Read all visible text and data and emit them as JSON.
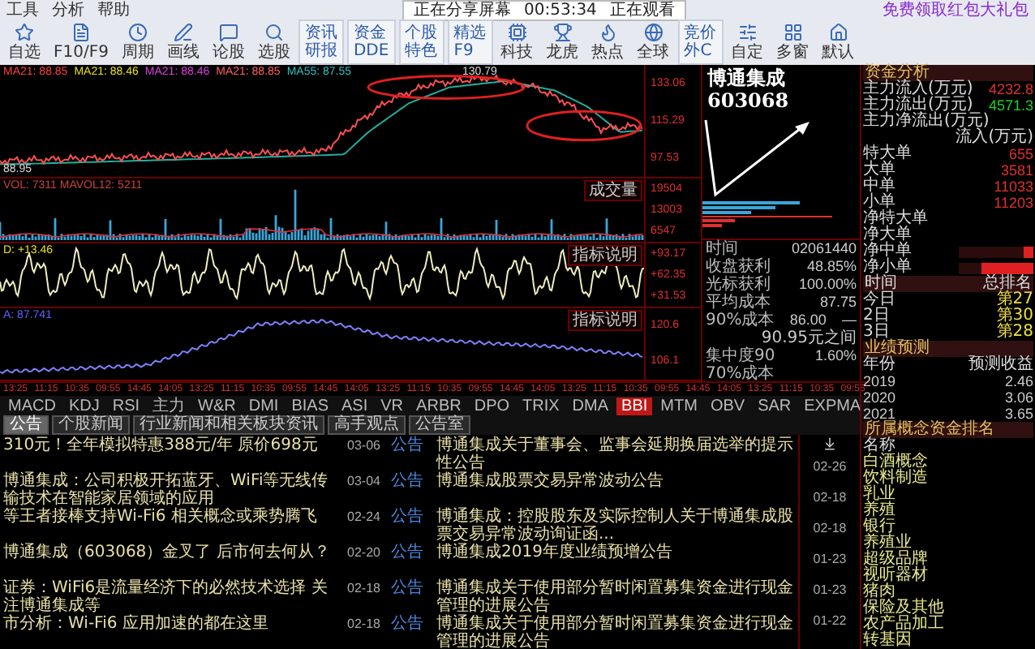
{
  "menu": [
    "工具",
    "分析",
    "帮助"
  ],
  "share_banner": {
    "status": "正在分享屏幕",
    "time": "00:53:34",
    "viewers": "正在观看"
  },
  "promo": "免费领取红包大礼包",
  "toolbar": [
    {
      "kind": "icon",
      "label": "自选"
    },
    {
      "kind": "icon",
      "label": "F10/F9"
    },
    {
      "kind": "icon",
      "label": "周期"
    },
    {
      "kind": "icon",
      "label": "画线"
    },
    {
      "kind": "icon",
      "label": "论股"
    },
    {
      "kind": "icon",
      "label": "选股"
    },
    {
      "kind": "stack",
      "labels": [
        "资讯",
        "研报"
      ]
    },
    {
      "kind": "stack",
      "labels": [
        "资金",
        "DDE"
      ]
    },
    {
      "kind": "stack",
      "labels": [
        "个股",
        "特色"
      ]
    },
    {
      "kind": "stack",
      "labels": [
        "精选",
        "F9"
      ]
    },
    {
      "kind": "icon",
      "label": "科技"
    },
    {
      "kind": "icon",
      "label": "龙虎"
    },
    {
      "kind": "icon",
      "label": "热点"
    },
    {
      "kind": "icon",
      "label": "全球"
    },
    {
      "kind": "stack",
      "labels": [
        "竞价",
        "外C"
      ]
    },
    {
      "kind": "icon",
      "label": "自定"
    },
    {
      "kind": "icon",
      "label": "多窗"
    },
    {
      "kind": "icon",
      "label": "默认"
    }
  ],
  "price_panel": {
    "legend": [
      {
        "text": "MA21: 88.85",
        "color": "#ff4040"
      },
      {
        "text": "MA21: 88.46",
        "color": "#e8e020"
      },
      {
        "text": "MA21: 88.46",
        "color": "#e040e0"
      },
      {
        "text": "MA21: 88.85",
        "color": "#ff6060"
      },
      {
        "text": "MA55: 87.55",
        "color": "#30c0c0"
      }
    ],
    "high_label": "130.79",
    "low_label": "88.95",
    "ticks": [
      "133.06",
      "115.29",
      "97.53"
    ]
  },
  "volume_panel": {
    "legend": "VOL: 7311 MAVOL12: 5211",
    "button": "成交量",
    "ticks": [
      "19504",
      "13003",
      "6547"
    ]
  },
  "oscillator_panel": {
    "legend": "D: +13.46",
    "button": "指标说明",
    "ticks": [
      "+93.17",
      "+62.35",
      "+31.53"
    ]
  },
  "indicator_panel": {
    "legend": "A: 87.741",
    "button": "指标说明",
    "ticks": [
      "120.6",
      "106.1"
    ]
  },
  "time_axis": [
    "13:25",
    "11:15",
    "10:35",
    "09:55",
    "14:45",
    "14:05",
    "13:25",
    "11:15",
    "10:35",
    "09:55",
    "14:45",
    "14:05",
    "13:25",
    "11:15",
    "10:35",
    "09:55",
    "14:45",
    "14:05",
    "13:25",
    "11:15",
    "10:35",
    "09:55",
    "14:45",
    "14:05",
    "13:25",
    "11:15",
    "10:35",
    "09:55"
  ],
  "indicator_tabs": [
    {
      "label": "MACD",
      "selected": false
    },
    {
      "label": "KDJ",
      "selected": false
    },
    {
      "label": "RSI",
      "selected": false
    },
    {
      "label": "主力",
      "selected": false
    },
    {
      "label": "W&R",
      "selected": false
    },
    {
      "label": "DMI",
      "selected": false
    },
    {
      "label": "BIAS",
      "selected": false
    },
    {
      "label": "ASI",
      "selected": false
    },
    {
      "label": "VR",
      "selected": false
    },
    {
      "label": "ARBR",
      "selected": false
    },
    {
      "label": "DPO",
      "selected": false
    },
    {
      "label": "TRIX",
      "selected": false
    },
    {
      "label": "DMA",
      "selected": false
    },
    {
      "label": "BBI",
      "selected": true
    },
    {
      "label": "MTM",
      "selected": false
    },
    {
      "label": "OBV",
      "selected": false
    },
    {
      "label": "SAR",
      "selected": false
    },
    {
      "label": "EXPMA",
      "selected": false
    }
  ],
  "news_tabs": [
    {
      "label": "公告",
      "selected": true
    },
    {
      "label": "个股新闻",
      "selected": false
    },
    {
      "label": "行业新闻和相关板块资讯",
      "selected": false
    },
    {
      "label": "高手观点",
      "selected": false
    },
    {
      "label": "公告室",
      "selected": false
    }
  ],
  "headlines": [
    "310元！全年模拟特惠388元/年 原价698元",
    "博通集成：公司积极开拓蓝牙、WiFi等无线传输技术在智能家居领域的应用",
    "等王者接棒支持Wi-Fi6 相关概念或乘势腾飞",
    "博通集成（603068）金叉了 后市何去何从？",
    "证券：WiFi6是流量经济下的必然技术选择 关注博通集成等",
    "市分析：Wi-Fi6 应用加速的都在这里"
  ],
  "announcements": [
    {
      "date": "03-06",
      "tag": "公告",
      "title": "博通集成关于董事会、监事会延期换届选举的提示性公告"
    },
    {
      "date": "03-04",
      "tag": "公告",
      "title": "博通集成股票交易异常波动公告"
    },
    {
      "date": "02-24",
      "tag": "公告",
      "title": "博通集成：控股股东及实际控制人关于博通集成股票交易异常波动询证函..."
    },
    {
      "date": "02-20",
      "tag": "公告",
      "title": "博通集成2019年度业绩预增公告"
    },
    {
      "date": "02-18",
      "tag": "公告",
      "title": "博通集成关于使用部分暂时闲置募集资金进行现金管理的进展公告"
    },
    {
      "date": "02-18",
      "tag": "公告",
      "title": "博通集成关于使用部分暂时闲置募集资金进行现金管理的进展公告"
    }
  ],
  "more_dates": [
    "02-26",
    "02-18",
    "02-18",
    "01-23",
    "01-23",
    "01-22"
  ],
  "stock_title": "博通集成 603068",
  "chip_info": [
    {
      "label": "时间",
      "value": "02061440"
    },
    {
      "label": "收盘获利",
      "value": "48.85%"
    },
    {
      "label": "光标获利",
      "value": "100.00%"
    },
    {
      "label": "平均成本",
      "value": "87.75"
    }
  ],
  "cost_range": {
    "label": "90%成本",
    "from": "86.00",
    "dash": "—",
    "to": "90.95元之间"
  },
  "concentration": {
    "label": "集中度90",
    "value": "1.60%"
  },
  "cost_70": "70%成本",
  "fund_flow": {
    "header": "资金分析",
    "inflow": {
      "label": "主力流入(万元)",
      "value": "4232.8"
    },
    "outflow": {
      "label": "主力流出(万元)",
      "value": "4571.3"
    },
    "net_label": "主力净流出(万元)",
    "column_label": "流入(万元)",
    "orders": [
      {
        "label": "特大单",
        "value": "655"
      },
      {
        "label": "大单",
        "value": "3581"
      },
      {
        "label": "中单",
        "value": "11033"
      },
      {
        "label": "小单",
        "value": "11203"
      }
    ],
    "net_orders": [
      {
        "label": "净特大单"
      },
      {
        "label": "净大单"
      },
      {
        "label": "净中单",
        "level": 0.12
      },
      {
        "label": "净小单",
        "level": 0.7
      }
    ]
  },
  "ranking": {
    "columns": [
      "时间",
      "总排名"
    ],
    "rows": [
      {
        "day": "今日",
        "rank": "第27"
      },
      {
        "day": "2日",
        "rank": "第30"
      },
      {
        "day": "3日",
        "rank": "第28"
      }
    ]
  },
  "forecast": {
    "title": "业绩预测",
    "columns": [
      "年份",
      "预测收益"
    ],
    "rows": [
      {
        "year": "2019",
        "eps": "2.46"
      },
      {
        "year": "2020",
        "eps": "3.06"
      },
      {
        "year": "2021",
        "eps": "3.65"
      }
    ]
  },
  "concepts": {
    "title": "所属概念资金排名",
    "column": "名称",
    "items": [
      "白酒概念",
      "饮料制造",
      "乳业",
      "养殖",
      "银行",
      "养殖业",
      "超级品牌",
      "视听器材",
      "猪肉",
      "保险及其他",
      "农产品加工",
      "转基因"
    ]
  }
}
